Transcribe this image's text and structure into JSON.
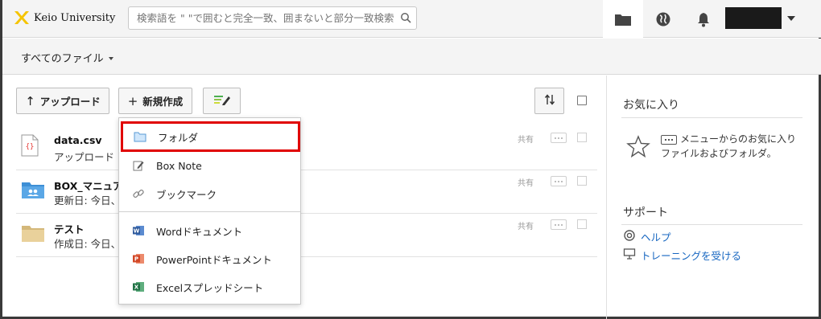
{
  "header": {
    "logo_text": "Keio University",
    "search_placeholder": "検索語を \" \"で囲むと完全一致、囲まないと部分一致検索",
    "icons": [
      "folder-icon",
      "globe-icon",
      "bell-icon"
    ],
    "account_caret": "chevron-down-icon"
  },
  "subheader": {
    "all_files": "すべてのファイル"
  },
  "toolbar": {
    "upload_label": "アップロード",
    "new_label": "新規作成"
  },
  "files": [
    {
      "name": "data.csv",
      "meta": "アップロード",
      "shared": "共有",
      "icon": "csv-file-icon"
    },
    {
      "name": "BOX_マニュア",
      "meta": "更新日: 今日、",
      "shared": "共有",
      "icon": "shared-folder-icon"
    },
    {
      "name": "テスト",
      "meta": "作成日: 今日、",
      "shared": "共有",
      "icon": "folder-icon"
    }
  ],
  "menu": {
    "items": [
      {
        "label": "フォルダ",
        "icon": "folder-icon"
      },
      {
        "label": "Box Note",
        "icon": "note-icon"
      },
      {
        "label": "ブックマーク",
        "icon": "link-icon"
      },
      {
        "label": "Wordドキュメント",
        "icon": "word-icon"
      },
      {
        "label": "PowerPointドキュメント",
        "icon": "powerpoint-icon"
      },
      {
        "label": "Excelスプレッドシート",
        "icon": "excel-icon"
      }
    ]
  },
  "right_panel": {
    "favorites_title": "お気に入り",
    "favorites_text": "メニューからのお気に入りファイルおよびフォルダ。",
    "support_title": "サポート",
    "help_label": "ヘルプ",
    "training_label": "トレーニングを受ける"
  },
  "colors": {
    "accent": "#1565c0",
    "highlight": "#e00000",
    "logo_yellow": "#f5c400",
    "word_blue": "#2b579a",
    "ppt_orange": "#d24726",
    "excel_green": "#217346"
  }
}
